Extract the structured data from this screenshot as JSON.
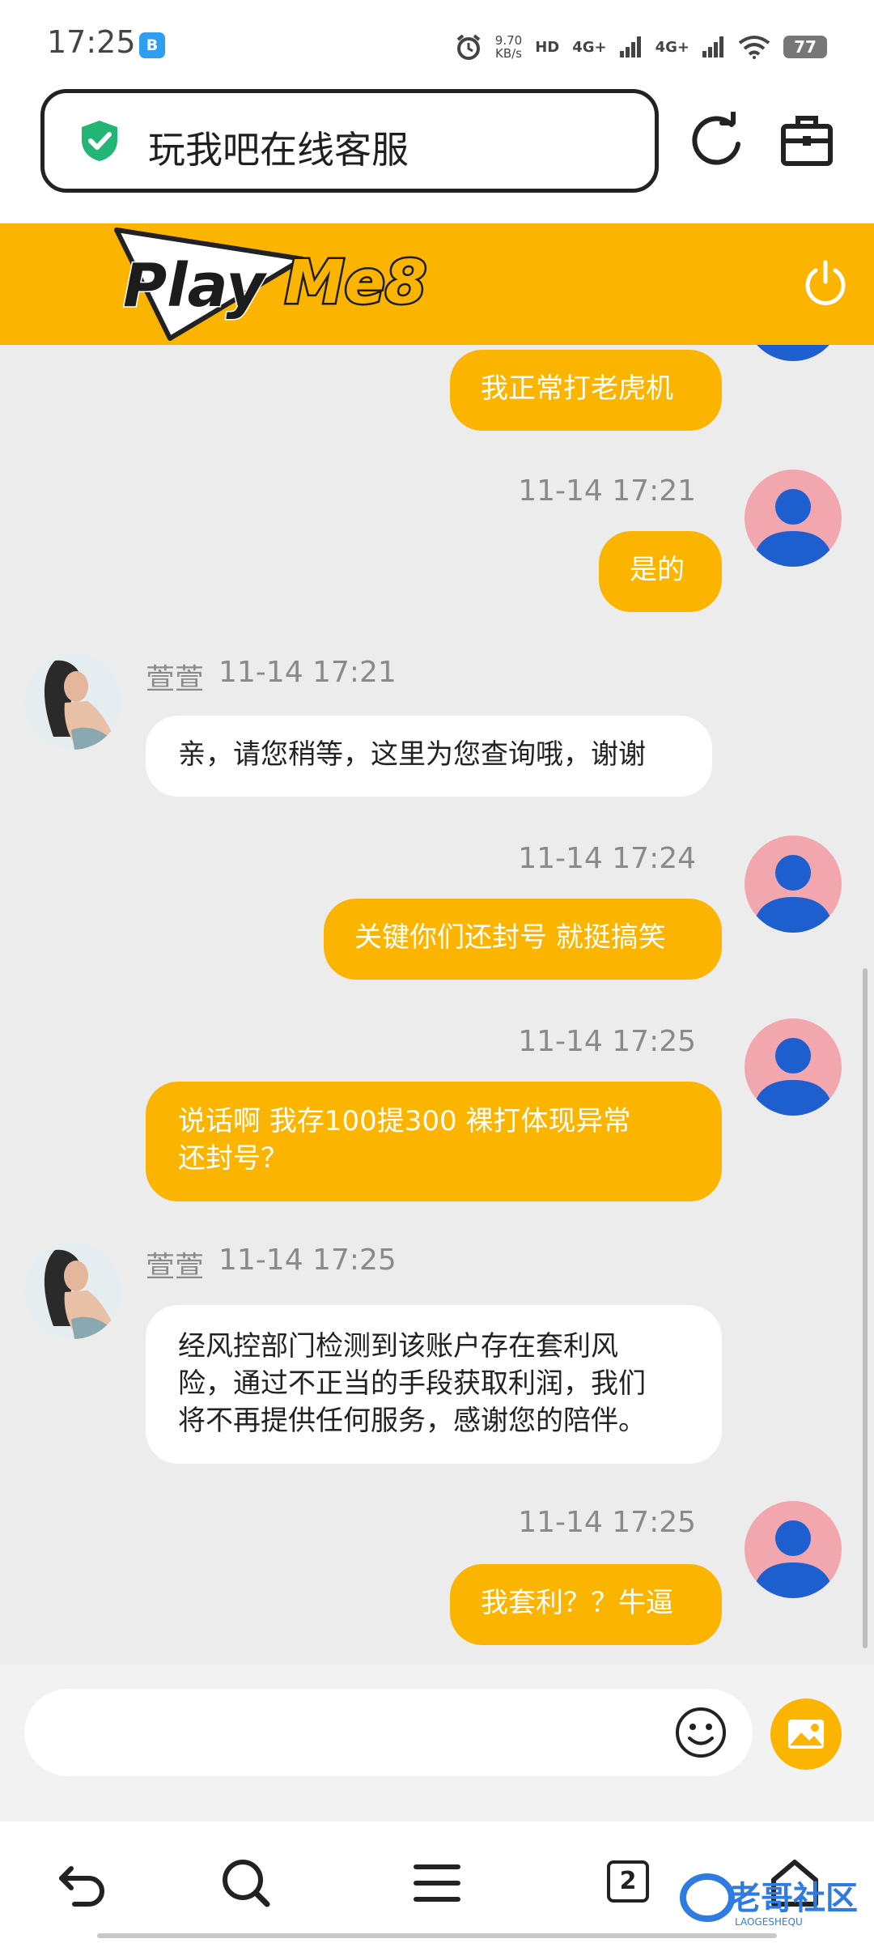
{
  "status_bar": {
    "time": "17:25",
    "app_icon_label": "B",
    "speed_value": "9.70",
    "speed_unit": "KB/s",
    "hd_label": "HD",
    "net1": "4G+",
    "net2": "4G+",
    "battery": "77"
  },
  "browser": {
    "url_title": "玩我吧在线客服",
    "secure_icon": "shield-check-icon",
    "refresh_icon": "refresh-icon",
    "toolbox_icon": "toolbox-icon"
  },
  "header": {
    "brand_logo_text": "PlayMe8",
    "power_icon": "power-icon"
  },
  "chat": {
    "messages": [
      {
        "sender": "user",
        "text": "我正常打老虎机"
      },
      {
        "sender": "user",
        "time": "11-14 17:21",
        "text": "是的"
      },
      {
        "sender": "agent",
        "name": "萱萱",
        "time": "11-14 17:21",
        "text": "亲，请您稍等，这里为您查询哦，谢谢"
      },
      {
        "sender": "user",
        "time": "11-14 17:24",
        "text": "关键你们还封号 就挺搞笑"
      },
      {
        "sender": "user",
        "time": "11-14 17:25",
        "text": "说话啊 我存100提300 裸打体现异常\n还封号？"
      },
      {
        "sender": "agent",
        "name": "萱萱",
        "time": "11-14 17:25",
        "text": "经风控部门检测到该账户存在套利风\n险，通过不正当的手段获取利润，我们\n将不再提供任何服务，感谢您的陪伴。"
      },
      {
        "sender": "user",
        "time": "11-14 17:25",
        "text": "我套利？？牛逼"
      }
    ]
  },
  "input": {
    "placeholder": "",
    "emoji_icon": "emoji-icon",
    "image_icon": "image-icon"
  },
  "nav": {
    "back_icon": "back-icon",
    "search_icon": "search-icon",
    "menu_icon": "menu-icon",
    "tab_count": "2",
    "home_icon": "home-icon",
    "watermark_text": "老哥社区",
    "watermark_sub": "LAOGESHEQU"
  },
  "colors": {
    "accent": "#fbb500",
    "chat_bg": "#ececec",
    "user_avatar_bg": "#f2a6ae",
    "user_avatar_fg": "#1e5fd0",
    "secure_green": "#22b573"
  }
}
